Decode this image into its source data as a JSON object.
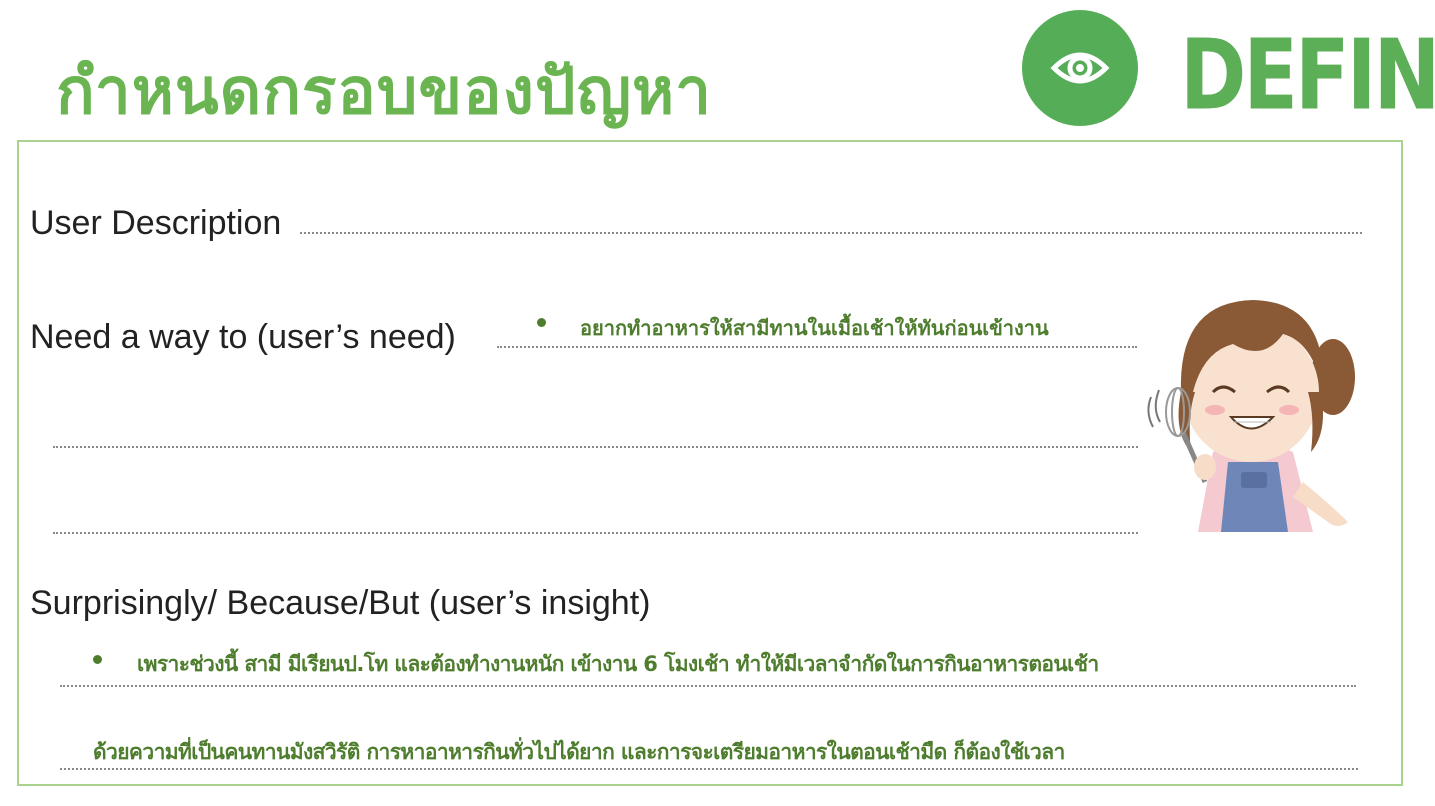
{
  "header": {
    "title": "กำหนดกรอบของปัญหา",
    "define_label": "DEFINE",
    "icon": "eye-icon"
  },
  "worksheet": {
    "user_description_label": "User Description",
    "need_label": "Need a way to (user’s need)",
    "need_answer": "อยากทำอาหารให้สามีทานในเมื้อเช้าให้ทันก่อนเข้างาน",
    "insight_label": "Surprisingly/ Because/But (user’s insight)",
    "insight_answer_1": "เพราะช่วงนี้ สามี มีเรียนป.โท และต้องทำงานหนัก เข้างาน 6 โมงเช้า ทำให้มีเวลาจำกัดในการกินอาหารตอนเช้า",
    "insight_answer_2": "ด้วยความที่เป็นคนทานมังสวิรัติ การหาอาหารกินทั่วไปได้ยาก และการจะเตรียมอาหารในตอนเช้ามืด ก็ต้องใช้เวลา"
  },
  "colors": {
    "accent_green": "#5cae57",
    "answer_green": "#4e7d2e",
    "frame_green": "#a9d28f"
  }
}
